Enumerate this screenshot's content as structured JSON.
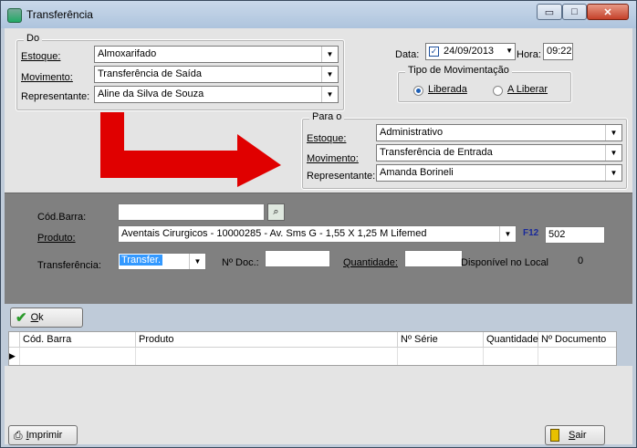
{
  "window": {
    "title": "Transferência",
    "minimize_glyph": "▭",
    "maximize_glyph": "□",
    "close_glyph": "✕",
    "icon": "app-icon"
  },
  "origin": {
    "group_label": "Do",
    "estoque_label": "Estoque:",
    "estoque_value": "Almoxarifado",
    "movimento_label": "Movimento:",
    "movimento_value": "Transferência de Saída",
    "representante_label": "Representante:",
    "representante_value": "Aline da Silva de Souza"
  },
  "date": {
    "label": "Data:",
    "checked": true,
    "value": "24/09/2013",
    "hora_label": "Hora:",
    "hora_value": "09:22"
  },
  "movement_type": {
    "group_label": "Tipo de Movimentação",
    "options": [
      "Liberada",
      "A Liberar"
    ],
    "selected": "Liberada"
  },
  "destination": {
    "group_label": "Para o",
    "estoque_label": "Estoque:",
    "estoque_value": "Administrativo",
    "movimento_label": "Movimento:",
    "movimento_value": "Transferência de Entrada",
    "representante_label": "Representante:",
    "representante_value": "Amanda Borineli"
  },
  "arrow_color": "#e00000",
  "product": {
    "barcode_label": "Cód.Barra:",
    "barcode_value": "",
    "produto_label": "Produto:",
    "produto_value": "Aventais Cirurgicos - 10000285 - Av. Sms G - 1,55 X 1,25 M Lifemed",
    "f12_label": "F12",
    "produto_code": "502",
    "transferencia_label": "Transferência:",
    "transferencia_value": "Transfer.",
    "ndoc_label": "Nº Doc.:",
    "ndoc_value": "",
    "quantidade_label": "Quantidade:",
    "quantidade_value": "",
    "disponivel_label": "Disponível no Local",
    "disponivel_value": "0"
  },
  "ok_button": {
    "label": "Ok",
    "underline": "O",
    "rest": "k"
  },
  "grid": {
    "columns": [
      "Cód. Barra",
      "Produto",
      "Nº Série",
      "Quantidade",
      "Nº Documento"
    ]
  },
  "print_button": {
    "underline": "I",
    "rest": "mprimir"
  },
  "exit_button": {
    "underline": "S",
    "rest": "air"
  }
}
